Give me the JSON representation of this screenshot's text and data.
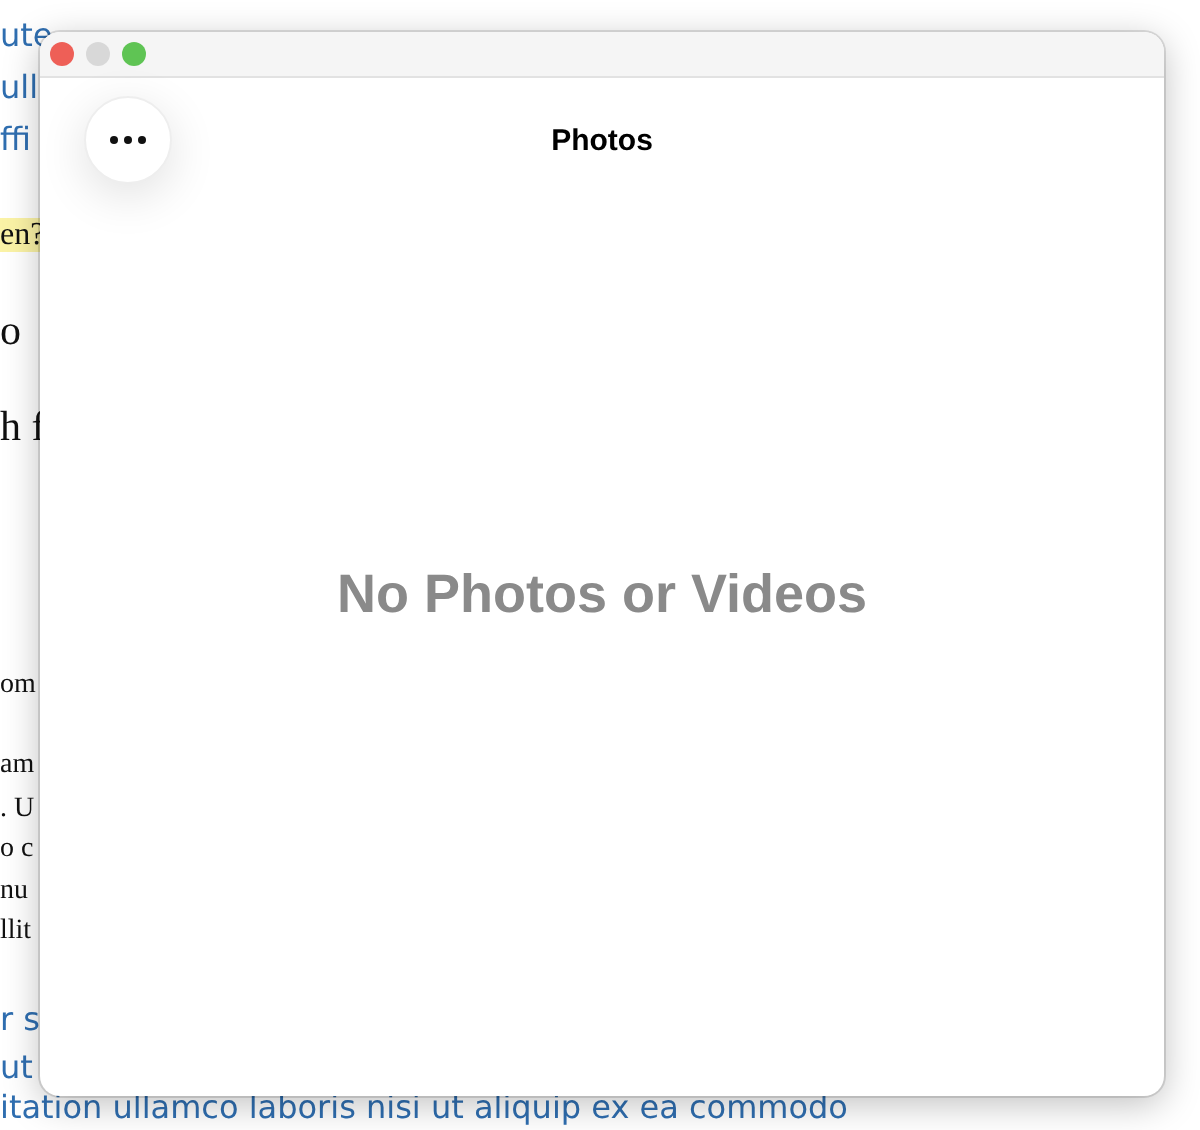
{
  "background": {
    "lines": [
      {
        "text": "ute",
        "kind": "link"
      },
      {
        "text": "ull",
        "kind": "link"
      },
      {
        "text": "ffi",
        "kind": "link"
      },
      {
        "text": "en?",
        "kind": "highlight"
      },
      {
        "text": "o",
        "kind": "heading"
      },
      {
        "text": "h f",
        "kind": "heading"
      },
      {
        "text": "om",
        "kind": "body"
      },
      {
        "text": "am",
        "kind": "body"
      },
      {
        "text": ". U",
        "kind": "body"
      },
      {
        "text": "o c",
        "kind": "body"
      },
      {
        "text": "nu",
        "kind": "body"
      },
      {
        "text": "llit",
        "kind": "body"
      },
      {
        "text": "r s",
        "kind": "link"
      },
      {
        "text": "ut",
        "kind": "link"
      },
      {
        "text": "itation ullamco laboris nisi ut aliquip ex ea commodo",
        "kind": "link"
      }
    ]
  },
  "window": {
    "controls": [
      {
        "kind": "close",
        "enabled": true
      },
      {
        "kind": "minimize",
        "enabled": false
      },
      {
        "kind": "zoom",
        "enabled": true
      }
    ],
    "title": "Photos",
    "empty_message": "No Photos or Videos"
  }
}
